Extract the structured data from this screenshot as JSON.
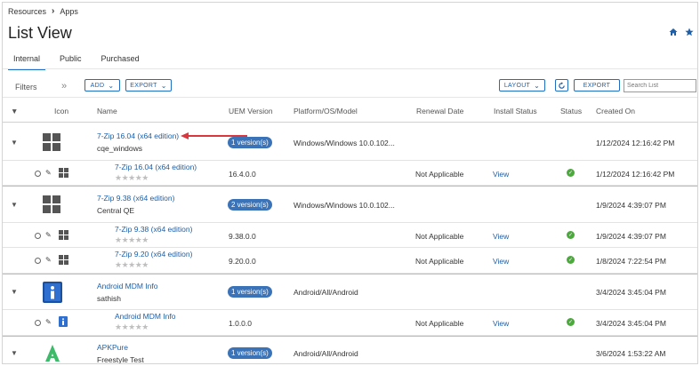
{
  "breadcrumb": {
    "root": "Resources",
    "current": "Apps"
  },
  "page_title": "List View",
  "tabs": [
    {
      "label": "Internal",
      "active": true
    },
    {
      "label": "Public",
      "active": false
    },
    {
      "label": "Purchased",
      "active": false
    }
  ],
  "toolbar": {
    "filters_label": "Filters",
    "add_label": "ADD",
    "export_label": "EXPORT",
    "layout_label": "LAYOUT",
    "export2_label": "EXPORT",
    "search_placeholder": "Search List"
  },
  "columns": {
    "icon": "Icon",
    "name": "Name",
    "uem_version": "UEM Version",
    "platform": "Platform/OS/Model",
    "renewal": "Renewal Date",
    "install_status": "Install Status",
    "status": "Status",
    "created_on": "Created On"
  },
  "apps": [
    {
      "name": "7-Zip 16.04 (x64 edition)",
      "owner": "cqe_windows",
      "versions_badge": "1 version(s)",
      "platform": "Windows/Windows 10.0.102...",
      "created_on": "1/12/2024 12:16:42 PM",
      "icon": "windows-icon",
      "children": [
        {
          "name": "7-Zip 16.04 (x64 edition)",
          "version": "16.4.0.0",
          "renewal": "Not Applicable",
          "install_status": "View",
          "created_on": "1/12/2024 12:16:42 PM"
        }
      ]
    },
    {
      "name": "7-Zip 9.38 (x64 edition)",
      "owner": "Central QE",
      "versions_badge": "2 version(s)",
      "platform": "Windows/Windows 10.0.102...",
      "created_on": "1/9/2024 4:39:07 PM",
      "icon": "windows-icon",
      "children": [
        {
          "name": "7-Zip 9.38 (x64 edition)",
          "version": "9.38.0.0",
          "renewal": "Not Applicable",
          "install_status": "View",
          "created_on": "1/9/2024 4:39:07 PM"
        },
        {
          "name": "7-Zip 9.20 (x64 edition)",
          "version": "9.20.0.0",
          "renewal": "Not Applicable",
          "install_status": "View",
          "created_on": "1/8/2024 7:22:54 PM"
        }
      ]
    },
    {
      "name": "Android MDM Info",
      "owner": "sathish",
      "versions_badge": "1 version(s)",
      "platform": "Android/All/Android",
      "created_on": "3/4/2024 3:45:04 PM",
      "icon": "info-icon",
      "children": [
        {
          "name": "Android MDM Info",
          "version": "1.0.0.0",
          "renewal": "Not Applicable",
          "install_status": "View",
          "created_on": "3/4/2024 3:45:04 PM"
        }
      ]
    },
    {
      "name": "APKPure",
      "owner": "Freestyle Test",
      "versions_badge": "1 version(s)",
      "platform": "Android/All/Android",
      "created_on": "3/6/2024 1:53:22 AM",
      "icon": "apkpure-icon",
      "children": []
    }
  ],
  "colors": {
    "accent": "#1e6fc4",
    "link": "#1e5fa8",
    "badge": "#3a73b8",
    "success": "#4caa3d",
    "annotation_arrow": "#d9363e"
  }
}
